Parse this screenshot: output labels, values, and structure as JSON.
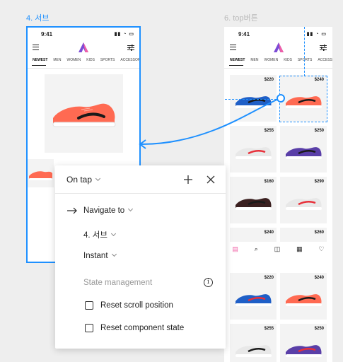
{
  "frames": {
    "selected_label": "4. 서브",
    "other_label": "6. top버튼"
  },
  "app": {
    "time": "9:41",
    "tabs": [
      "NEWEST",
      "MEN",
      "WOMEN",
      "KIDS",
      "SPORTS",
      "ACCESSORIES"
    ],
    "active_tab": "NEWEST",
    "logo_letter": "A",
    "prices": [
      "$220",
      "$240",
      "$255",
      "$250",
      "$160",
      "$290",
      "$240",
      "$260",
      "$220",
      "$240",
      "$255",
      "$250"
    ]
  },
  "interaction": {
    "trigger": "On tap",
    "action": "Navigate to",
    "destination": "4. 서브",
    "animation": "Instant",
    "state_header": "State management",
    "options": [
      {
        "label": "Reset scroll position",
        "checked": false
      },
      {
        "label": "Reset component state",
        "checked": false
      }
    ]
  },
  "colors": {
    "accent": "#1e90ff",
    "shoe_coral": "#ff6a52",
    "shoe_blue": "#1f5fc7",
    "shoe_purple": "#5a3fa8",
    "logo_purple": "#7b4bd6",
    "logo_pink": "#f05fa6"
  }
}
